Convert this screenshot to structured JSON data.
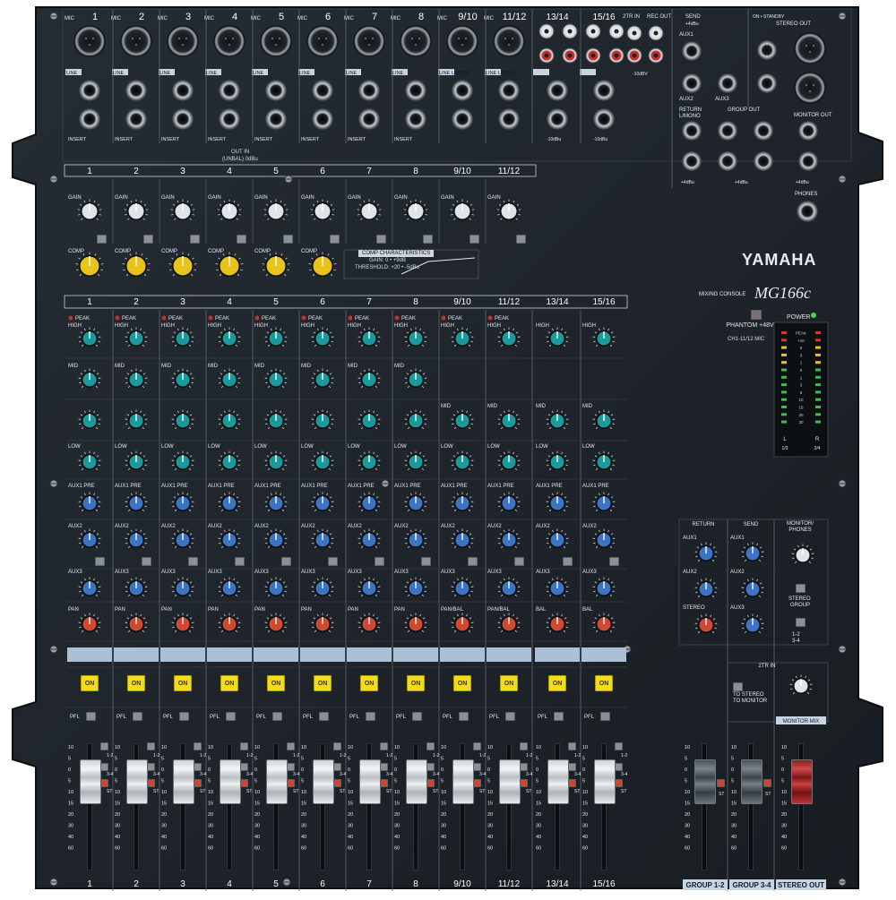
{
  "brand": {
    "name": "YAMAHA",
    "series_label": "MIXING CONSOLE",
    "model": "MG166c"
  },
  "colors": {
    "panel": "#1c2228",
    "knob_teal": "#1a9a9a",
    "knob_blue": "#3b74c2",
    "knob_red": "#cf4a33",
    "knob_yellow": "#e8c41a",
    "on_button": "#f2dd1c",
    "group_bar": "#a9c0d6"
  },
  "input_channels": [
    "1",
    "2",
    "3",
    "4",
    "5",
    "6",
    "7",
    "8",
    "9/10",
    "11/12",
    "13/14",
    "15/16"
  ],
  "mic_jack_labels": [
    "MIC",
    "MIC",
    "MIC",
    "MIC",
    "MIC",
    "MIC",
    "MIC",
    "MIC",
    "MIC",
    "MIC"
  ],
  "mic_channel_numbers": [
    "1",
    "2",
    "3",
    "4",
    "5",
    "6",
    "7",
    "8",
    "9/10",
    "11/12"
  ],
  "line_labels": [
    "LINE",
    "LINE",
    "LINE",
    "LINE",
    "LINE",
    "LINE",
    "LINE",
    "LINE",
    "LINE L/MONO",
    "LINE L/MONO",
    "LINE",
    "LINE"
  ],
  "insert_label": "INSERT",
  "out_in_label": "OUT IN",
  "unbal_label": "(UNBAL) 0dBu",
  "rca_labels": {
    "ch13": "13/14",
    "ch15": "15/16",
    "twotr_in": "2TR IN",
    "rec_out": "REC OUT",
    "level": "-10dBV",
    "line_level": "-10dBu"
  },
  "right_jacks": {
    "send": "SEND",
    "send_level": "+4dBu",
    "aux1": "AUX1",
    "aux2": "AUX2",
    "aux3": "AUX3",
    "return": "RETURN",
    "lmono": "L/MONO",
    "group_out": "GROUP OUT",
    "monitor_out": "MONITOR OUT",
    "stereo_out": "STEREO OUT",
    "on_standby": "ON • STANDBY",
    "phones": "PHONES",
    "level": "+4dBu"
  },
  "strip_labels": {
    "gain": "GAIN",
    "comp": "COMP",
    "peak": "PEAK",
    "high": "HIGH",
    "mid": "MID",
    "low": "LOW",
    "aux1_pre": "AUX1 PRE",
    "aux2": "AUX2",
    "aux3": "AUX3",
    "pan": "PAN",
    "pan_bal": "PAN/BAL",
    "bal": "BAL",
    "on": "ON",
    "pfl": "PFL",
    "pre": "PRE",
    "st": "ST",
    "g12": "1-2",
    "g34": "3-4"
  },
  "comp_characteristics": {
    "title": "COMP CHARACTERISTICS",
    "gain": "GAIN: 0 • +9dB",
    "threshold": "THRESHOLD: +20 • -5dBu"
  },
  "phantom": {
    "label": "PHANTOM +48V",
    "sub": "CH1-11/12 MIC"
  },
  "power_label": "POWER",
  "meter": {
    "scale": [
      "PEAK",
      "+10",
      "6",
      "3",
      "1",
      "0",
      "1",
      "3",
      "6",
      "10",
      "15",
      "20",
      "30"
    ],
    "left": "L",
    "right": "R",
    "left_sub": "1/3",
    "right_sub": "2/4"
  },
  "master": {
    "return": "RETURN",
    "send": "SEND",
    "monitor_phones": "MONITOR/ PHONES",
    "aux1": "AUX1",
    "aux2": "AUX2",
    "aux3": "AUX3",
    "stereo": "STEREO",
    "stereo_group": "STEREO GROUP",
    "g12_34": "1-2 3-4",
    "twotr_in": "2TR IN",
    "to_stereo": "TO STEREO",
    "to_monitor": "TO MONITOR",
    "monitor_mix": "MONITOR MIX"
  },
  "fader_scale": [
    "10",
    "5",
    "0",
    "5",
    "10",
    "15",
    "20",
    "30",
    "40",
    "60"
  ],
  "bottom_labels": {
    "group12": "GROUP 1-2",
    "group34": "GROUP 3-4",
    "stereo_out": "STEREO OUT"
  }
}
